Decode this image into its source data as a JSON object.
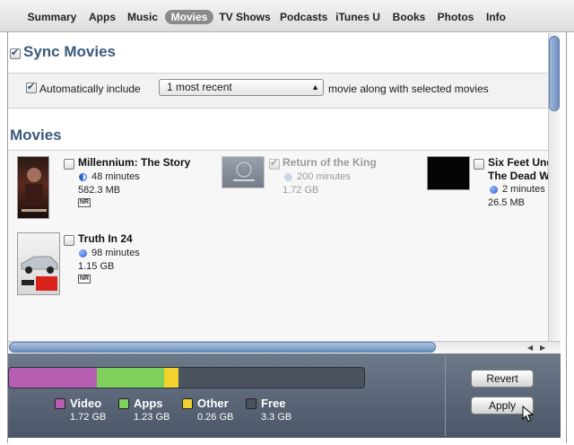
{
  "tabs": [
    {
      "label": "Summary",
      "active": false
    },
    {
      "label": "Apps",
      "active": false
    },
    {
      "label": "Music",
      "active": false
    },
    {
      "label": "Movies",
      "active": true
    },
    {
      "label": "TV Shows",
      "active": false
    },
    {
      "label": "Podcasts",
      "active": false
    },
    {
      "label": "iTunes U",
      "active": false
    },
    {
      "label": "Books",
      "active": false
    },
    {
      "label": "Photos",
      "active": false
    },
    {
      "label": "Info",
      "active": false
    }
  ],
  "sync": {
    "title": "Sync Movies",
    "checked": true,
    "auto_label": "Automatically include",
    "auto_checked": true,
    "select_value": "1 most recent",
    "after_select": "movie along with selected movies"
  },
  "movies_section": {
    "title": "Movies",
    "items": [
      {
        "title": "Millennium: The Story",
        "duration": "48 minutes",
        "size": "582.3 MB",
        "rating": "NR",
        "checked": false,
        "dimmed": false,
        "played": "half"
      },
      {
        "title": "Return of the King",
        "duration": "200 minutes",
        "size": "1.72 GB",
        "rating": "",
        "checked": true,
        "dimmed": true,
        "played": "none"
      },
      {
        "title": "Six Feet Und",
        "title_line2": "The Dead W",
        "duration": "2 minutes",
        "size": "26.5 MB",
        "rating": "",
        "checked": false,
        "dimmed": false,
        "played": "full"
      },
      {
        "title": "Truth In 24",
        "duration": "98 minutes",
        "size": "1.15 GB",
        "rating": "NR",
        "checked": false,
        "dimmed": false,
        "played": "full"
      }
    ]
  },
  "capacity": {
    "segments": [
      {
        "name": "Video",
        "value": "1.72 GB",
        "color": "#b65fb2",
        "fraction": 0.248
      },
      {
        "name": "Apps",
        "value": "1.23 GB",
        "color": "#7fcf5c",
        "fraction": 0.19
      },
      {
        "name": "Other",
        "value": "0.26 GB",
        "color": "#f2d22e",
        "fraction": 0.04
      },
      {
        "name": "Free",
        "value": "3.3 GB",
        "color": "#4a5260",
        "fraction": 0.522
      }
    ]
  },
  "buttons": {
    "revert": "Revert",
    "apply": "Apply"
  },
  "colors": {
    "section_title": "#3b5a7a",
    "bottom_bar": "#5a6576"
  }
}
